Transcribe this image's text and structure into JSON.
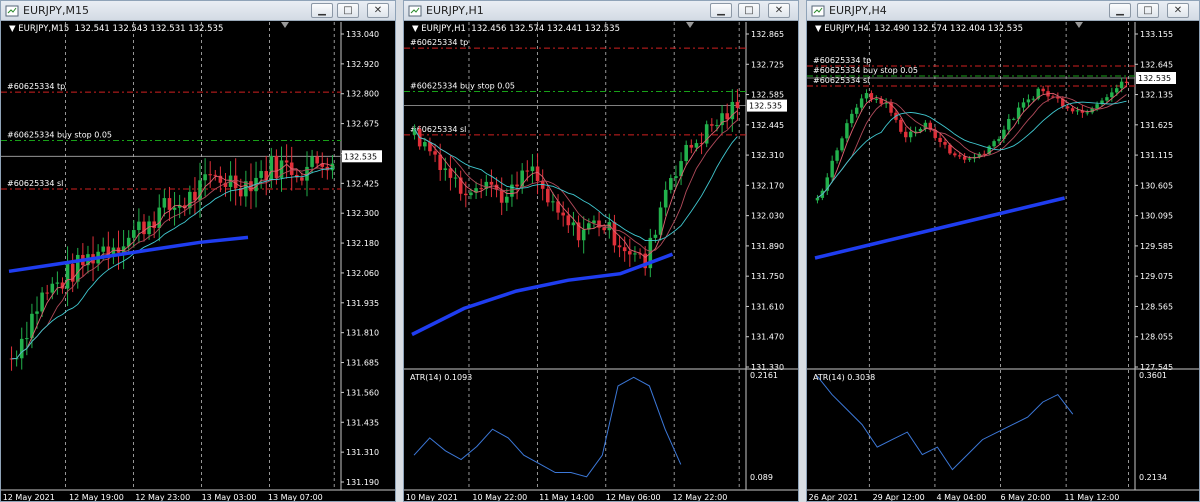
{
  "colors": {
    "bull": "#22b14c",
    "bear": "#e0303a",
    "ma_fast": "#e06070",
    "ma_mid": "#b04a5a",
    "ma_slow": "#40c8d0",
    "ma_long": "#1f3df0",
    "tp_sl": "#d02020",
    "buy": "#18a018",
    "atr": "#3c78d8"
  },
  "windows": [
    {
      "title": "EURJPY,M15",
      "header_symbol": "EURJPY,M15",
      "header_ohlc": "132.541 132.543 132.531 132.535",
      "price_axis": [
        "133.040",
        "132.920",
        "132.800",
        "132.675",
        "132.550",
        "132.425",
        "132.300",
        "132.180",
        "132.060",
        "131.935",
        "131.810",
        "131.685",
        "131.560",
        "131.435",
        "131.310",
        "131.190"
      ],
      "current_price": "132.535",
      "time_axis": [
        "12 May 2021",
        "12 May 19:00",
        "12 May 23:00",
        "13 May 03:00",
        "13 May 07:00"
      ],
      "order_tp": "#60625334 tp",
      "order_buy": "#60625334 buy stop 0.05",
      "order_sl": "#60625334 sl",
      "indicator_label": "",
      "indicator_max": "",
      "indicator_min": ""
    },
    {
      "title": "EURJPY,H1",
      "header_symbol": "EURJPY,H1",
      "header_ohlc": "132.456 132.574 132.441 132.535",
      "price_axis": [
        "132.865",
        "132.725",
        "132.585",
        "132.445",
        "132.310",
        "132.170",
        "132.030",
        "131.890",
        "131.750",
        "131.610",
        "131.470",
        "131.330"
      ],
      "current_price": "132.535",
      "time_axis": [
        "10 May 2021",
        "10 May 22:00",
        "11 May 14:00",
        "12 May 06:00",
        "12 May 22:00"
      ],
      "order_tp": "#60625334 tp",
      "order_buy": "#60625334 buy stop 0.05",
      "order_sl": "#60625334 sl",
      "indicator_label": "ATR(14) 0.1093",
      "indicator_max": "0.2161",
      "indicator_min": "0.089"
    },
    {
      "title": "EURJPY,H4",
      "header_symbol": "EURJPY,H4",
      "header_ohlc": "132.490 132.574 132.404 132.535",
      "price_axis": [
        "133.155",
        "132.645",
        "132.135",
        "131.625",
        "131.115",
        "130.605",
        "130.095",
        "129.585",
        "129.075",
        "128.565",
        "128.055",
        "127.545"
      ],
      "current_price": "132.535",
      "time_axis": [
        "26 Apr 2021",
        "29 Apr 12:00",
        "4 May 04:00",
        "6 May 20:00",
        "11 May 12:00"
      ],
      "order_tp": "#60625334 tp",
      "order_buy": "#60625334 buy stop 0.05",
      "order_sl": "#60625334 sl",
      "indicator_label": "ATR(14) 0.3038",
      "indicator_max": "0.3601",
      "indicator_min": "0.2134"
    }
  ],
  "chart_data": [
    {
      "type": "candlestick",
      "symbol": "EURJPY",
      "timeframe": "M15",
      "ylim": [
        131.19,
        133.04
      ],
      "current_price": 132.535,
      "tp": 132.8,
      "buy_stop": 132.6,
      "sl": 132.4,
      "close_trend": [
        131.7,
        131.95,
        132.05,
        132.15,
        132.2,
        132.3,
        132.35,
        132.45,
        132.42,
        132.5,
        132.48,
        132.535
      ],
      "ma_long": [
        132.06,
        132.09,
        132.12,
        132.15,
        132.18,
        132.2
      ],
      "time_axis": [
        "12 May 2021",
        "12 May 19:00",
        "12 May 23:00",
        "13 May 03:00",
        "13 May 07:00"
      ]
    },
    {
      "type": "candlestick",
      "symbol": "EURJPY",
      "timeframe": "H1",
      "ylim": [
        131.33,
        132.865
      ],
      "current_price": 132.535,
      "tp": 132.8,
      "buy_stop": 132.6,
      "sl": 132.4,
      "close_trend": [
        132.4,
        132.3,
        132.15,
        132.2,
        132.1,
        132.25,
        132.05,
        131.95,
        132.0,
        131.9,
        131.8,
        132.2,
        132.35,
        132.45,
        132.535
      ],
      "ma_long": [
        131.48,
        131.6,
        131.68,
        131.73,
        131.76,
        131.85
      ],
      "indicator": {
        "name": "ATR(14)",
        "value": 0.1093,
        "ylim": [
          0.089,
          0.2161
        ],
        "values": [
          0.12,
          0.14,
          0.125,
          0.115,
          0.13,
          0.15,
          0.14,
          0.12,
          0.11,
          0.1,
          0.1,
          0.095,
          0.12,
          0.2,
          0.21,
          0.2,
          0.15,
          0.1093
        ]
      },
      "time_axis": [
        "10 May 2021",
        "10 May 22:00",
        "11 May 14:00",
        "12 May 06:00",
        "12 May 22:00"
      ]
    },
    {
      "type": "candlestick",
      "symbol": "EURJPY",
      "timeframe": "H4",
      "ylim": [
        127.545,
        133.155
      ],
      "current_price": 132.535,
      "tp": 132.8,
      "buy_stop": 132.6,
      "sl": 132.4,
      "close_trend": [
        130.5,
        131.5,
        132.3,
        132.2,
        131.6,
        131.8,
        131.3,
        131.2,
        131.5,
        132.0,
        132.4,
        132.2,
        132.0,
        132.3,
        132.535
      ],
      "ma_long": [
        129.9,
        130.2,
        130.5,
        130.8,
        131.1
      ],
      "indicator": {
        "name": "ATR(14)",
        "value": 0.3038,
        "ylim": [
          0.2134,
          0.3601
        ],
        "values": [
          0.355,
          0.33,
          0.31,
          0.29,
          0.26,
          0.27,
          0.28,
          0.25,
          0.26,
          0.23,
          0.25,
          0.27,
          0.28,
          0.29,
          0.3,
          0.32,
          0.33,
          0.3038
        ]
      },
      "time_axis": [
        "26 Apr 2021",
        "29 Apr 12:00",
        "4 May 04:00",
        "6 May 20:00",
        "11 May 12:00"
      ]
    }
  ]
}
